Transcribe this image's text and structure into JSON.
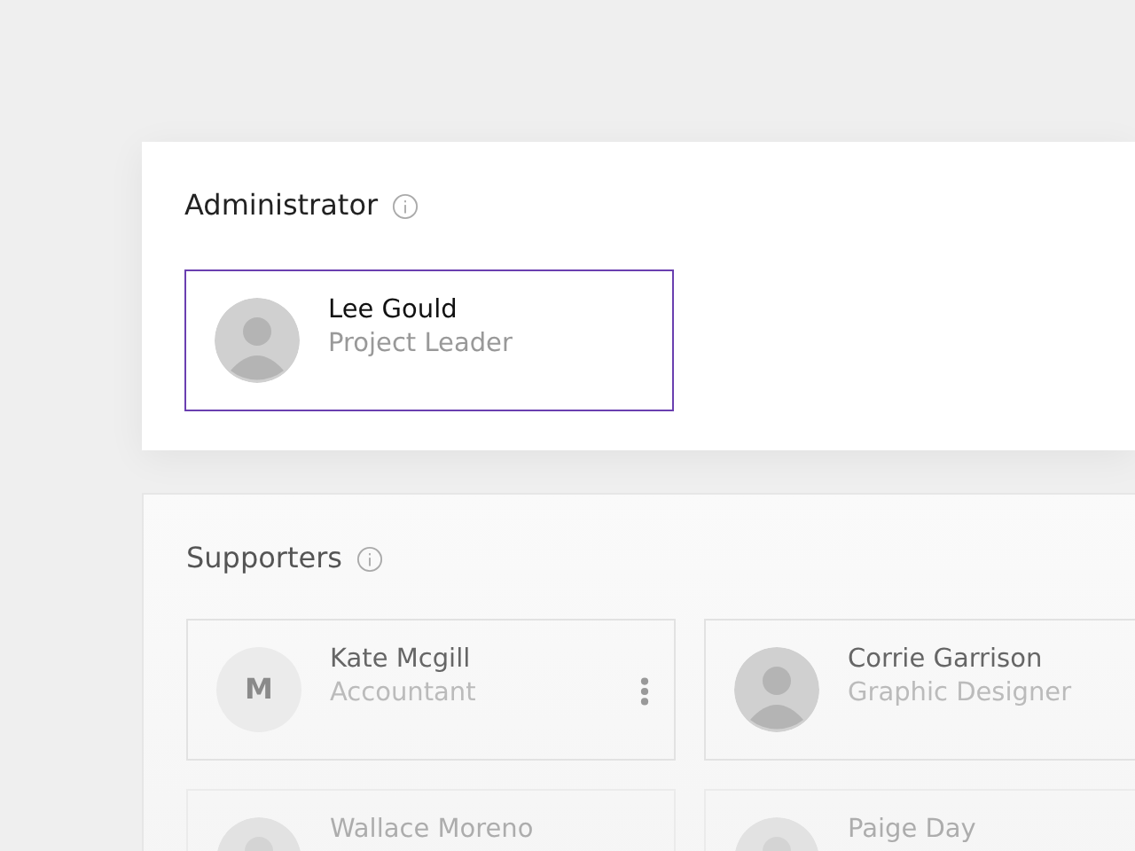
{
  "administrator": {
    "title": "Administrator",
    "members": [
      {
        "name": "Lee Gould",
        "role": "Project Leader",
        "avatar": {
          "kind": "photo"
        },
        "selected": true,
        "menu": false
      }
    ]
  },
  "supporters": {
    "title": "Supporters",
    "members": [
      {
        "name": "Kate Mcgill",
        "role": "Accountant",
        "avatar": {
          "kind": "initial",
          "text": "M"
        },
        "selected": false,
        "menu": true
      },
      {
        "name": "Corrie Garrison",
        "role": "Graphic Designer",
        "avatar": {
          "kind": "photo"
        },
        "selected": false,
        "menu": false
      },
      {
        "name": "Wallace Moreno",
        "avatar": {
          "kind": "photo"
        },
        "selected": false,
        "menu": false
      },
      {
        "name": "Paige Day",
        "avatar": {
          "kind": "photo"
        },
        "selected": false,
        "menu": false
      }
    ]
  }
}
